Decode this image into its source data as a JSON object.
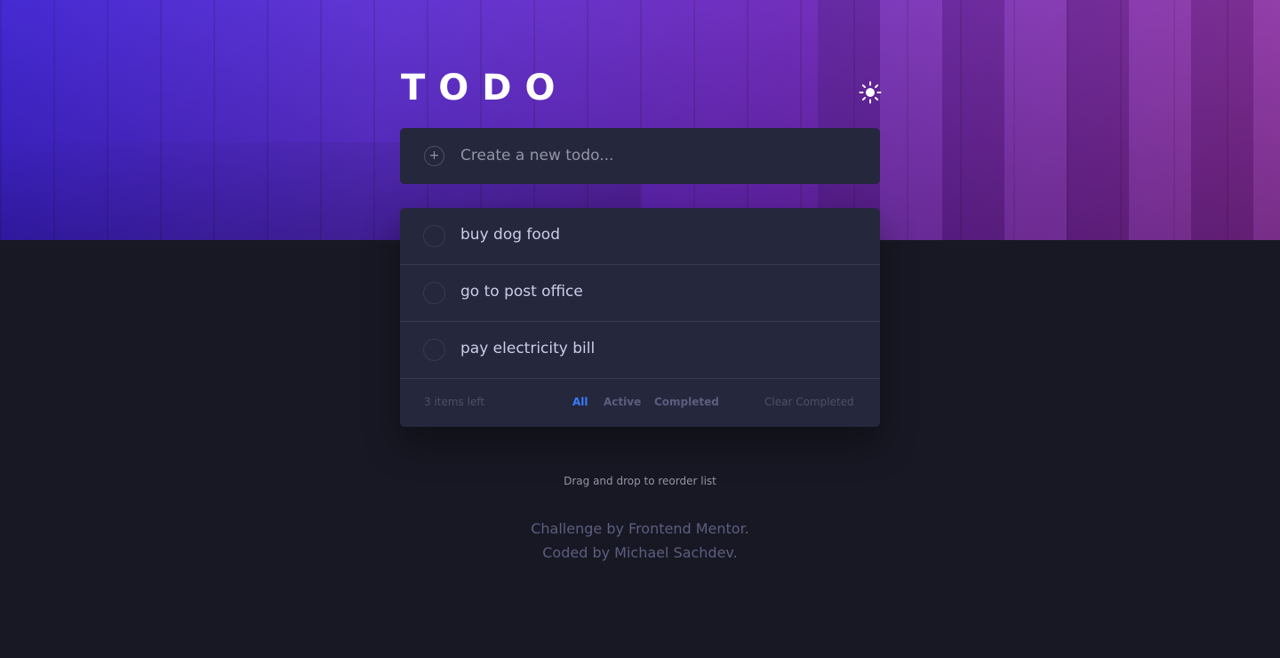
{
  "app": {
    "title": "TODO",
    "theme_icon": "sun-icon"
  },
  "new_todo": {
    "placeholder": "Create a new todo...",
    "icon": "plus-icon",
    "icon_glyph": "+"
  },
  "todos": [
    {
      "text": "buy dog food",
      "completed": false
    },
    {
      "text": "go to post office",
      "completed": false
    },
    {
      "text": "pay electricity bill",
      "completed": false
    }
  ],
  "footer": {
    "items_left": "3 items left",
    "filters": [
      "All",
      "Active",
      "Completed"
    ],
    "selected_filter": "All",
    "clear_label": "Clear Completed"
  },
  "hint": "Drag and drop to reorder list",
  "attribution": {
    "line1": "Challenge by Frontend Mentor.",
    "line2": "Coded by Michael Sachdev."
  },
  "colors": {
    "page_bg": "#181824",
    "card_bg": "#25273d",
    "accent": "#3a7bfd",
    "text": "#cacde8"
  }
}
